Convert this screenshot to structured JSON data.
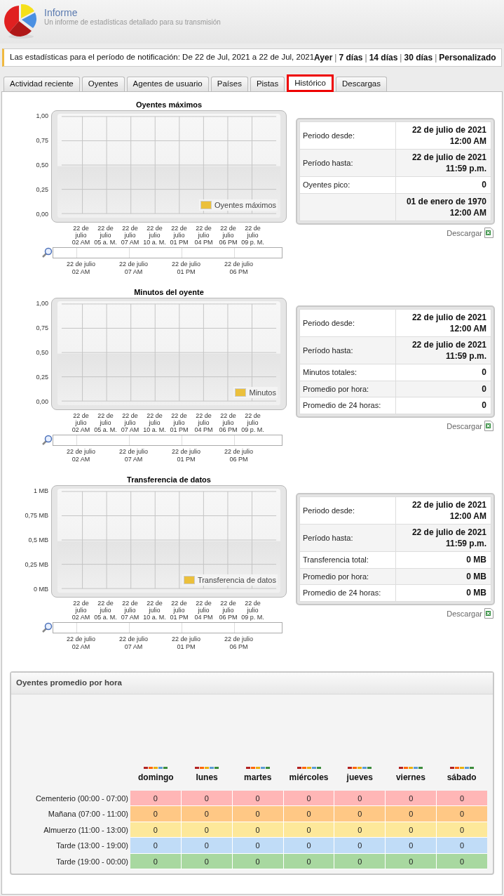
{
  "header": {
    "title": "Informe",
    "subtitle": "Un informe de estadísticas detallado para su transmisión"
  },
  "period_bar": {
    "text": "Las estadísticas para el período de notificación: De 22 de Jul, 2021 a 22 de Jul, 2021",
    "separator": "|",
    "links": [
      "Ayer",
      "7 días",
      "14 días",
      "30 días",
      "Personalizado"
    ]
  },
  "tabs": [
    {
      "label": "Actividad reciente",
      "selected": false
    },
    {
      "label": "Oyentes",
      "selected": false
    },
    {
      "label": "Agentes de usuario",
      "selected": false
    },
    {
      "label": "Países",
      "selected": false
    },
    {
      "label": "Pistas",
      "selected": false
    },
    {
      "label": "Histórico",
      "selected": true
    },
    {
      "label": "Descargas",
      "selected": false
    }
  ],
  "sections": [
    {
      "chart_data": {
        "type": "line",
        "grid": true,
        "title": "Oyentes máximos",
        "categories": [
          "22 de julio\n02 AM",
          "22 de julio\n05 a. M.",
          "22 de julio\n07 AM",
          "22 de julio\n10 a. M.",
          "22 de julio\n01 PM",
          "22 de julio\n04 PM",
          "22 de julio\n06 PM",
          "22 de julio\n09 p. M."
        ],
        "ylim": [
          0,
          1
        ],
        "yticks": [
          {
            "value": 0,
            "label": "0,00"
          },
          {
            "value": 0.25,
            "label": "0,25"
          },
          {
            "value": 0.5,
            "label": "0,50"
          },
          {
            "value": 0.75,
            "label": "0,75"
          },
          {
            "value": 1,
            "label": "1,00"
          }
        ],
        "series": [
          {
            "name": "Oyentes máximos",
            "color": "#ebc03c",
            "values": [
              null,
              null,
              null,
              null,
              null,
              null,
              null,
              null
            ]
          }
        ]
      },
      "navigator_labels": [
        "22 de julio\n02 AM",
        "22 de julio\n07 AM",
        "22 de julio\n01 PM",
        "22 de julio\n06 PM"
      ],
      "stats": [
        {
          "label": "Periodo desde:",
          "value": [
            "22 de julio de 2021",
            "12:00 AM"
          ]
        },
        {
          "label": "Período hasta:",
          "value": [
            "22 de julio de 2021",
            "11:59 p.m."
          ]
        },
        {
          "label": "Oyentes pico:",
          "value": [
            "0"
          ]
        },
        {
          "value": [
            "01 de enero de 1970",
            "12:00 AM"
          ]
        }
      ],
      "download": "Descargar"
    },
    {
      "chart_data": {
        "type": "line",
        "grid": true,
        "title": "Minutos del oyente",
        "categories": [
          "22 de julio\n02 AM",
          "22 de julio\n05 a. M.",
          "22 de julio\n07 AM",
          "22 de julio\n10 a. M.",
          "22 de julio\n01 PM",
          "22 de julio\n04 PM",
          "22 de julio\n06 PM",
          "22 de julio\n09 p. M."
        ],
        "ylim": [
          0,
          1
        ],
        "yticks": [
          {
            "value": 0,
            "label": "0,00"
          },
          {
            "value": 0.25,
            "label": "0,25"
          },
          {
            "value": 0.5,
            "label": "0,50"
          },
          {
            "value": 0.75,
            "label": "0,75"
          },
          {
            "value": 1,
            "label": "1,00"
          }
        ],
        "series": [
          {
            "name": "Minutos",
            "color": "#ebc03c",
            "values": [
              null,
              null,
              null,
              null,
              null,
              null,
              null,
              null
            ]
          }
        ]
      },
      "navigator_labels": [
        "22 de julio\n02 AM",
        "22 de julio\n07 AM",
        "22 de julio\n01 PM",
        "22 de julio\n06 PM"
      ],
      "stats": [
        {
          "label": "Periodo desde:",
          "value": [
            "22 de julio de 2021",
            "12:00 AM"
          ]
        },
        {
          "label": "Período hasta:",
          "value": [
            "22 de julio de 2021",
            "11:59 p.m."
          ]
        },
        {
          "label": "Minutos totales:",
          "value": [
            "0"
          ]
        },
        {
          "label": "Promedio por hora:",
          "value": [
            "0"
          ]
        },
        {
          "label": "Promedio de 24 horas:",
          "value": [
            "0"
          ]
        }
      ],
      "download": "Descargar"
    },
    {
      "chart_data": {
        "type": "line",
        "grid": true,
        "title": "Transferencia de datos",
        "categories": [
          "22 de julio\n02 AM",
          "22 de julio\n05 a. M.",
          "22 de julio\n07 AM",
          "22 de julio\n10 a. M.",
          "22 de julio\n01 PM",
          "22 de julio\n04 PM",
          "22 de julio\n06 PM",
          "22 de julio\n09 p. M."
        ],
        "ylim": [
          0,
          1
        ],
        "yticks": [
          {
            "value": 0,
            "label": "0 MB"
          },
          {
            "value": 0.25,
            "label": "0,25 MB"
          },
          {
            "value": 0.5,
            "label": "0,5 MB"
          },
          {
            "value": 0.75,
            "label": "0,75 MB"
          },
          {
            "value": 1,
            "label": "1 MB"
          }
        ],
        "series": [
          {
            "name": "Transferencia de datos",
            "color": "#ebc03c",
            "values": [
              null,
              null,
              null,
              null,
              null,
              null,
              null,
              null
            ]
          }
        ]
      },
      "navigator_labels": [
        "22 de julio\n02 AM",
        "22 de julio\n07 AM",
        "22 de julio\n01 PM",
        "22 de julio\n06 PM"
      ],
      "stats": [
        {
          "label": "Periodo desde:",
          "value": [
            "22 de julio de 2021",
            "12:00 AM"
          ]
        },
        {
          "label": "Período hasta:",
          "value": [
            "22 de julio de 2021",
            "11:59 p.m."
          ]
        },
        {
          "label": "Transferencia total:",
          "value": [
            "0 MB"
          ]
        },
        {
          "label": "Promedio por hora:",
          "value": [
            "0 MB"
          ]
        },
        {
          "label": "Promedio de 24 horas:",
          "value": [
            "0 MB"
          ]
        }
      ],
      "download": "Descargar"
    }
  ],
  "hourly": {
    "title": "Oyentes promedio por hora",
    "days": [
      "domingo",
      "lunes",
      "martes",
      "miércoles",
      "jueves",
      "viernes",
      "sábado"
    ],
    "rows": [
      {
        "label": "Cementerio (00:00 - 07:00)",
        "color": "#ffb6b6",
        "cells": [
          "0",
          "0",
          "0",
          "0",
          "0",
          "0",
          "0"
        ]
      },
      {
        "label": "Mañana (07:00 - 11:00)",
        "color": "#ffc885",
        "cells": [
          "0",
          "0",
          "0",
          "0",
          "0",
          "0",
          "0"
        ]
      },
      {
        "label": "Almuerzo (11:00 - 13:00)",
        "color": "#fde89a",
        "cells": [
          "0",
          "0",
          "0",
          "0",
          "0",
          "0",
          "0"
        ]
      },
      {
        "label": "Tarde (13:00 - 19:00)",
        "color": "#c0dcf7",
        "cells": [
          "0",
          "0",
          "0",
          "0",
          "0",
          "0",
          "0"
        ]
      },
      {
        "label": "Tarde (19:00 - 00:00)",
        "color": "#a8d8a0",
        "cells": [
          "0",
          "0",
          "0",
          "0",
          "0",
          "0",
          "0"
        ]
      }
    ]
  }
}
